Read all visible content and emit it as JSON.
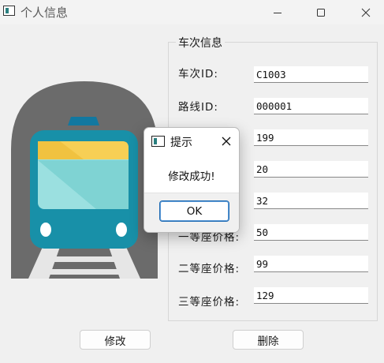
{
  "window": {
    "title": "个人信息"
  },
  "group": {
    "title": "车次信息",
    "fields": [
      {
        "label": "车次ID:",
        "value": "C1003"
      },
      {
        "label": "路线ID:",
        "value": "000001"
      },
      {
        "label": "",
        "value": "199"
      },
      {
        "label": "",
        "value": "20"
      },
      {
        "label": "",
        "value": "32"
      },
      {
        "label": "一等座价格:",
        "value": "50"
      },
      {
        "label": "二等座价格:",
        "value": "99"
      },
      {
        "label": "三等座价格:",
        "value": "129"
      }
    ]
  },
  "buttons": {
    "modify": "修改",
    "delete": "删除"
  },
  "dialog": {
    "title": "提示",
    "message": "修改成功!",
    "ok": "OK"
  },
  "colors": {
    "train_body": "#1890a8",
    "tunnel": "#6b6b6b",
    "windshield": "#9be0e0",
    "roof_strip": "#f7cf55"
  }
}
